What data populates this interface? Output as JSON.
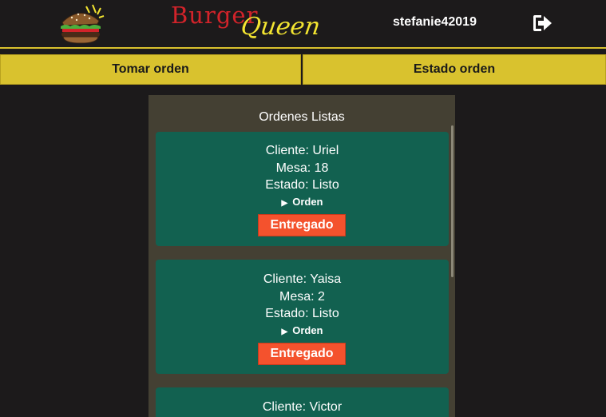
{
  "header": {
    "brand_word1": "Burger",
    "brand_word2": "Queen",
    "username": "stefanie42019",
    "logout_icon": "sign-out-icon"
  },
  "tabs": [
    {
      "label": "Tomar orden"
    },
    {
      "label": "Estado orden"
    }
  ],
  "panel": {
    "title": "Ordenes Listas",
    "orders": [
      {
        "cliente": "Cliente: Uriel",
        "mesa": "Mesa: 18",
        "estado": "Estado: Listo",
        "summary": "Orden",
        "button": "Entregado"
      },
      {
        "cliente": "Cliente: Yaisa",
        "mesa": "Mesa: 2",
        "estado": "Estado: Listo",
        "summary": "Orden",
        "button": "Entregado"
      },
      {
        "cliente": "Cliente: Victor"
      }
    ]
  },
  "colors": {
    "background": "#1c1a1b",
    "accent_yellow": "#d9c22e",
    "card_green": "#126150",
    "button_orange": "#f4522d",
    "panel_bg": "#444033"
  }
}
